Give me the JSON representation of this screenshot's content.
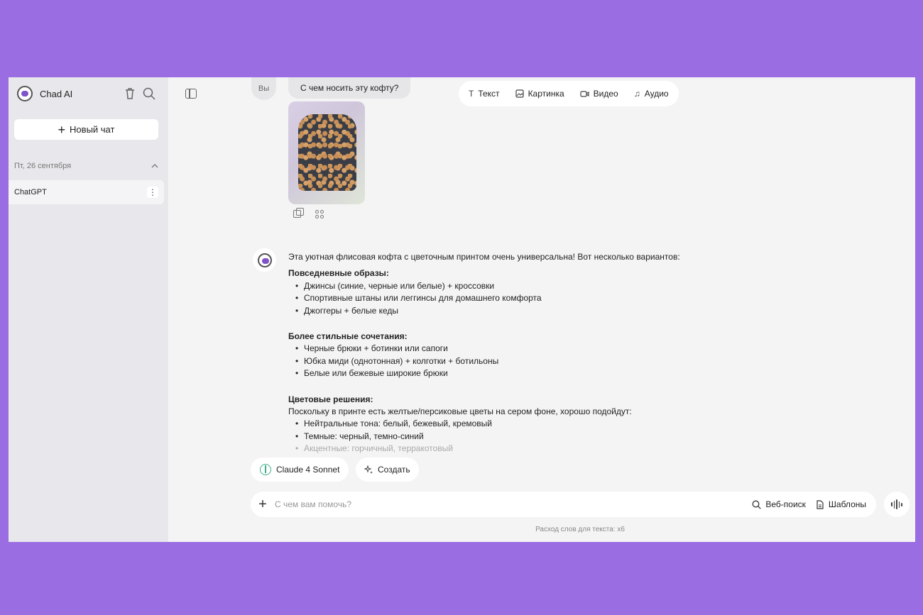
{
  "app": {
    "name": "Chad AI"
  },
  "sidebar": {
    "new_chat_label": "Новый чат",
    "date_group": "Пт, 26 сентября",
    "chats": [
      {
        "title": "ChatGPT"
      }
    ]
  },
  "conversation": {
    "user_label": "Вы",
    "user_message": "С чем носить эту кофту?",
    "answer": {
      "intro": "Эта уютная флисовая кофта с цветочным принтом очень универсальна! Вот несколько вариантов:",
      "section1_title": "Повседневные образы:",
      "section1_items": [
        "Джинсы (синие, черные или белые) + кроссовки",
        "Спортивные штаны или леггинсы для домашнего комфорта",
        "Джоггеры + белые кеды"
      ],
      "section2_title": "Более стильные сочетания:",
      "section2_items": [
        "Черные брюки + ботинки или сапоги",
        "Юбка миди (однотонная) + колготки + ботильоны",
        "Белые или бежевые широкие брюки"
      ],
      "section3_title": "Цветовые решения:",
      "section3_text": "Поскольку в принте есть желтые/персиковые цветы на сером фоне, хорошо подойдут:",
      "section3_items": [
        "Нейтральные тона: белый, бежевый, кремовый",
        "Темные: черный, темно-синий",
        "Акцентные: горчичный, терракотовый"
      ]
    }
  },
  "mode_tabs": [
    "Текст",
    "Картинка",
    "Видео",
    "Аудио"
  ],
  "composer": {
    "model_label": "Claude 4 Sonnet",
    "create_label": "Создать",
    "placeholder": "С чем вам помочь?",
    "web_search_label": "Веб-поиск",
    "templates_label": "Шаблоны",
    "footnote": "Расход слов для текста: x6"
  },
  "colors": {
    "background": "#9b6de3",
    "accent_model": "#3fae86"
  }
}
